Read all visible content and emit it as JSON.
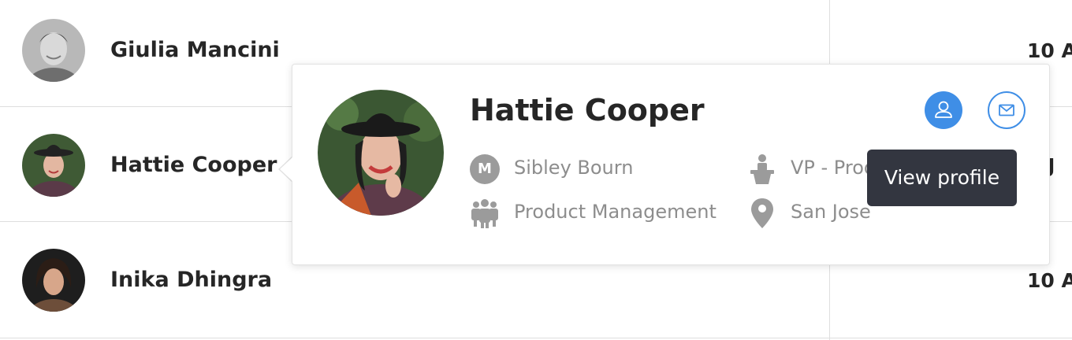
{
  "rows": [
    {
      "name": "Giulia Mancini",
      "date": "10 A"
    },
    {
      "name": "Hattie Cooper",
      "date": "9 J"
    },
    {
      "name": "Inika Dhingra",
      "date": "10 A"
    }
  ],
  "popover": {
    "name": "Hattie Cooper",
    "manager_initial": "M",
    "manager": "Sibley Bourn",
    "title": "VP - Prod",
    "department": "Product Management",
    "location": "San Jose",
    "tooltip": "View profile",
    "icons": {
      "profile": "user-icon",
      "mail": "mail-icon",
      "department": "people-icon",
      "title": "podium-icon",
      "location": "map-pin-icon"
    }
  },
  "colors": {
    "accent": "#3f8ee6",
    "tooltip_bg": "#333640",
    "meta_text": "#8d8d8d"
  }
}
